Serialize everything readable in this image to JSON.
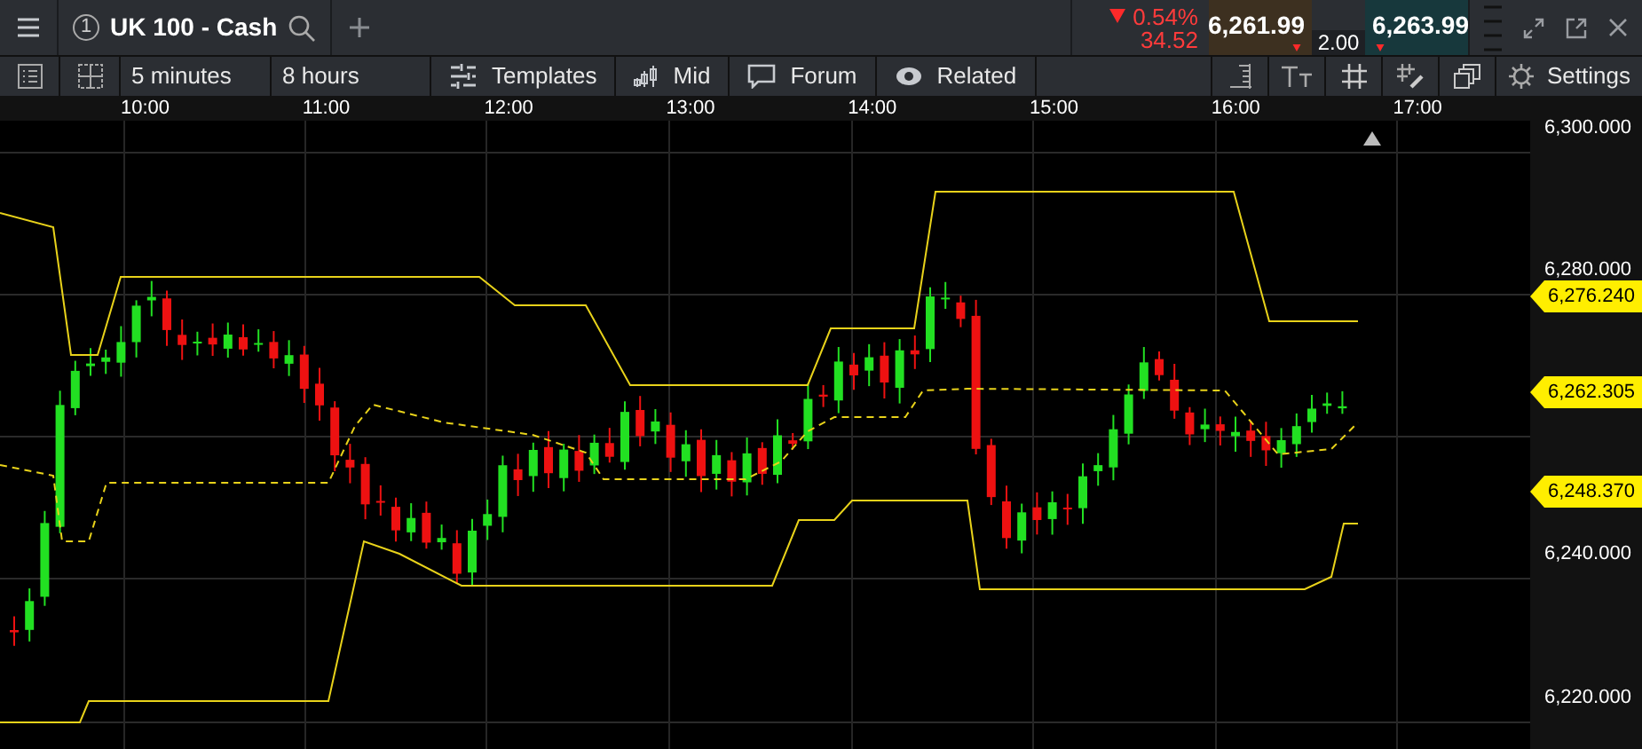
{
  "tabs": [
    {
      "number": "1",
      "label": "UK 100 - Cash"
    }
  ],
  "quote": {
    "change_percent": "0.54%",
    "change_points": "34.52",
    "sell": "6,261.99",
    "buy": "6,263.99",
    "spread": "2.00"
  },
  "toolbar": {
    "interval": "5 minutes",
    "range": "8 hours",
    "buttons": [
      {
        "kind": "templates",
        "label": "Templates"
      },
      {
        "kind": "price",
        "label": "Mid"
      },
      {
        "kind": "forum",
        "label": "Forum"
      },
      {
        "kind": "related",
        "label": "Related"
      }
    ],
    "settings": "Settings"
  },
  "time_axis": [
    "10:00",
    "11:00",
    "12:00",
    "13:00",
    "14:00",
    "15:00",
    "16:00",
    "17:00"
  ],
  "price_axis": [
    "6,300.000",
    "6,280.000",
    "6,240.000",
    "6,220.000"
  ],
  "price_markers": [
    "6,276.240",
    "6,262.305",
    "6,248.370"
  ]
}
